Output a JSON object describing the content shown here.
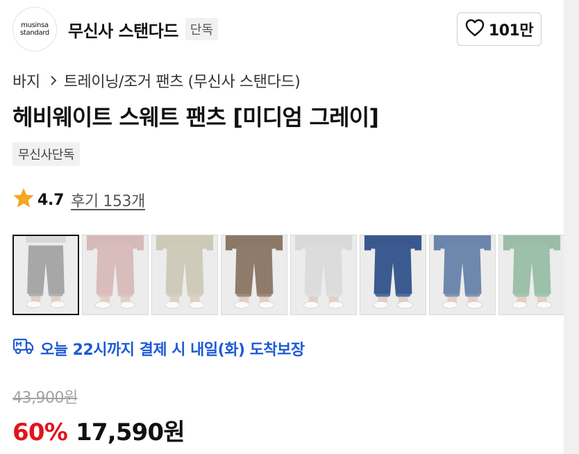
{
  "brand": {
    "logo_line1": "musinsa",
    "logo_line2": "standard",
    "name": "무신사 스탠다드",
    "tag": "단독",
    "like_count": "101만"
  },
  "breadcrumb": {
    "category": "바지",
    "subcategory": "트레이닝/조거 팬츠 (무신사 스탠다드)"
  },
  "product": {
    "title": "헤비웨이트 스웨트 팬츠 [미디엄 그레이]",
    "badge": "무신사단독",
    "rating": "4.7",
    "reviews": "후기 153개"
  },
  "thumbnails": [
    {
      "color_name": "medium gray",
      "pants": "#a7a7a7",
      "top": null,
      "selected": true
    },
    {
      "color_name": "pink",
      "pants": "#d9bcbc",
      "top": "#d6b9b9",
      "selected": false
    },
    {
      "color_name": "beige",
      "pants": "#cfcbba",
      "top": "#cdc9b8",
      "selected": false
    },
    {
      "color_name": "brown",
      "pants": "#8f7b69",
      "top": "#8c7867",
      "selected": false
    },
    {
      "color_name": "light gray",
      "pants": "#dcdcdc",
      "top": "#d9d9d9",
      "selected": false
    },
    {
      "color_name": "navy",
      "pants": "#3b5a90",
      "top": "#3a588d",
      "selected": false
    },
    {
      "color_name": "blue gray",
      "pants": "#6e87ad",
      "top": "#6c85aa",
      "selected": false
    },
    {
      "color_name": "mint",
      "pants": "#9cc0aa",
      "top": "#99bda7",
      "selected": false
    }
  ],
  "delivery": {
    "text": "오늘 22시까지 결제 시 내일(화) 도착보장"
  },
  "price": {
    "original": "43,900원",
    "discount": "60%",
    "final": "17,590원"
  },
  "colors": {
    "accent_blue": "#1c5ad6",
    "discount_red": "#e3131b",
    "star": "#f5a623"
  }
}
